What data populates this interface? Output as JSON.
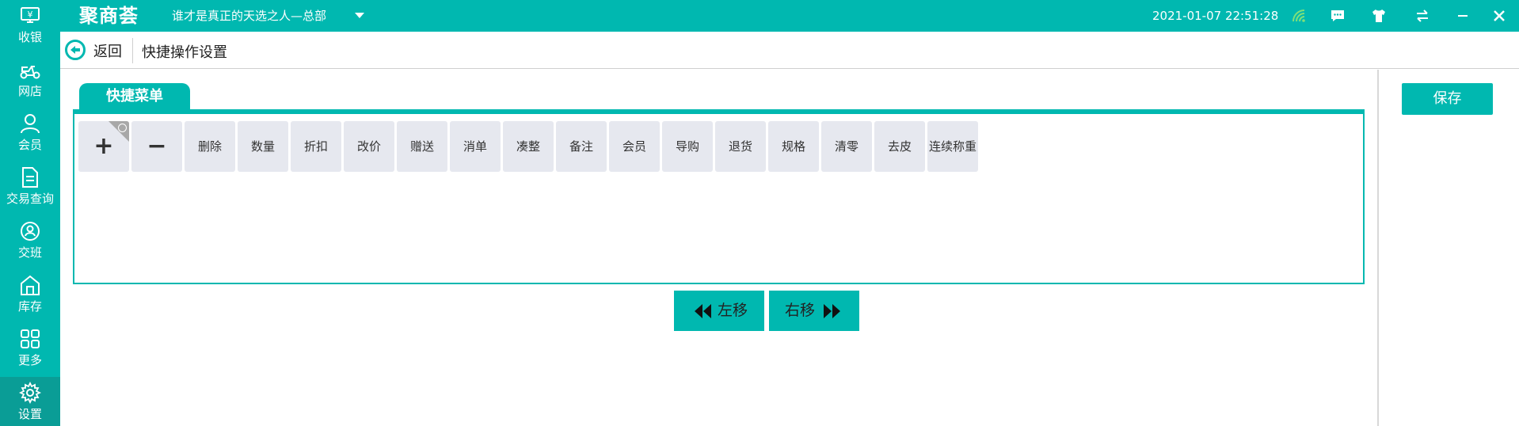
{
  "app": {
    "logo_text": "聚商荟",
    "store_name": "谁才是真正的天选之人—总部",
    "datetime": "2021-01-07 22:51:28"
  },
  "topbar_icons": [
    "wifi-icon",
    "message-icon",
    "shirt-icon",
    "switch-icon",
    "minimize-icon",
    "close-icon"
  ],
  "sidebar": {
    "items": [
      {
        "label": "收银",
        "icon": "cashier-icon"
      },
      {
        "label": "网店",
        "icon": "scooter-icon"
      },
      {
        "label": "会员",
        "icon": "member-icon"
      },
      {
        "label": "交易查询",
        "icon": "document-icon"
      },
      {
        "label": "交班",
        "icon": "handover-icon"
      },
      {
        "label": "库存",
        "icon": "warehouse-icon"
      },
      {
        "label": "更多",
        "icon": "grid-icon"
      },
      {
        "label": "设置",
        "icon": "gear-icon",
        "active": true
      }
    ]
  },
  "header": {
    "back_label": "返回",
    "page_title": "快捷操作设置"
  },
  "panel": {
    "tab_label": "快捷菜单",
    "buttons": [
      {
        "label": "+"
      },
      {
        "label": "−"
      },
      {
        "label": "删除"
      },
      {
        "label": "数量"
      },
      {
        "label": "折扣"
      },
      {
        "label": "改价"
      },
      {
        "label": "赠送"
      },
      {
        "label": "消单"
      },
      {
        "label": "凑整"
      },
      {
        "label": "备注"
      },
      {
        "label": "会员"
      },
      {
        "label": "导购"
      },
      {
        "label": "退货"
      },
      {
        "label": "规格"
      },
      {
        "label": "清零"
      },
      {
        "label": "去皮"
      },
      {
        "label": "连续称重"
      }
    ]
  },
  "actions": {
    "move_left_label": "左移",
    "move_right_label": "右移",
    "save_label": "保存"
  },
  "colors": {
    "accent": "#00b8b0",
    "button_bg": "#e6e8ef"
  }
}
